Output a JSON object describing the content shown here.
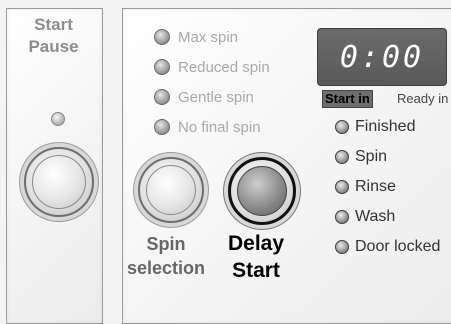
{
  "start_pause": {
    "line1": "Start",
    "line2": "Pause"
  },
  "spin_options": [
    {
      "label": "Max spin"
    },
    {
      "label": "Reduced spin"
    },
    {
      "label": "Gentle spin"
    },
    {
      "label": "No final spin"
    }
  ],
  "spin_selection": {
    "line1": "Spin",
    "line2": "selection"
  },
  "delay_start": {
    "line1": "Delay",
    "line2": "Start"
  },
  "display": {
    "time": "0:00"
  },
  "start_in_label": "Start in",
  "ready_in_label": "Ready in",
  "status_indicators": [
    {
      "label": "Finished"
    },
    {
      "label": "Spin"
    },
    {
      "label": "Rinse"
    },
    {
      "label": "Wash"
    },
    {
      "label": "Door locked"
    }
  ]
}
